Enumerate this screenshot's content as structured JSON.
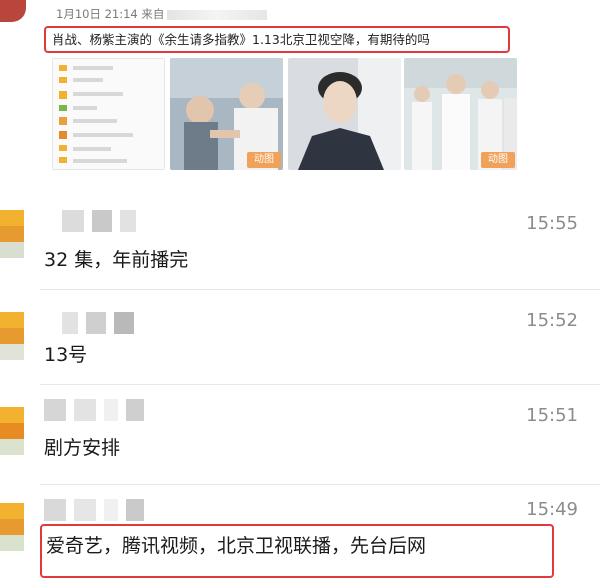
{
  "post": {
    "meta": "1月10日 21:14 来自",
    "title": "肖战、杨紫主演的《余生请多指教》1.13北京卫视空降，有期待的吗",
    "thumbnails": [
      {
        "kind": "collage"
      },
      {
        "kind": "photo",
        "badge": "动图"
      },
      {
        "kind": "photo",
        "badge": ""
      },
      {
        "kind": "photo",
        "badge": "动图"
      }
    ]
  },
  "comments": [
    {
      "time": "15:55",
      "text": "32 集，年前播完"
    },
    {
      "time": "15:52",
      "text": "13号"
    },
    {
      "time": "15:51",
      "text": "剧方安排"
    },
    {
      "time": "15:49",
      "text": "爱奇艺，腾讯视频，北京卫视联播，先台后网"
    }
  ],
  "colors": {
    "highlight": "#e3393c",
    "badge": "#f0a15a",
    "time": "#8c8c8c"
  }
}
